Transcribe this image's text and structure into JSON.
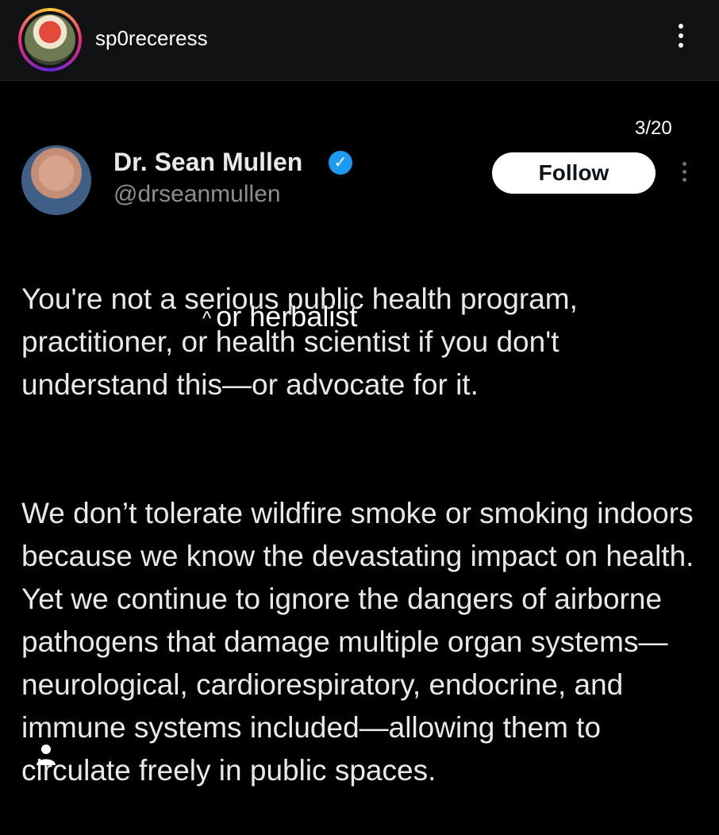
{
  "header": {
    "username": "sp0receress",
    "avatar_icon": "mushroom-avatar",
    "more_icon": "more-vertical-icon"
  },
  "carousel": {
    "counter": "3/20"
  },
  "tweet": {
    "author_name": "Dr. Sean Mullen",
    "handle": "@drseanmullen",
    "verified": true,
    "follow_label": "Follow",
    "paragraphs": [
      "You're not a serious public health program, practitioner, or health scientist if you don't understand this—or advocate for it.",
      "We don’t tolerate wildfire smoke or smoking indoors because we know the devastating impact on health. Yet we continue to ignore the dangers of airborne pathogens that damage multiple organ systems— neurological, cardiorespiratory, endocrine, and immune systems included—allowing them to circulate freely in public spaces."
    ]
  },
  "overlay": {
    "caret": "^",
    "text": "or herbalist"
  },
  "colors": {
    "verified_blue": "#1d9bf0",
    "text": "#e7e9ea",
    "handle": "#8b8f94"
  }
}
